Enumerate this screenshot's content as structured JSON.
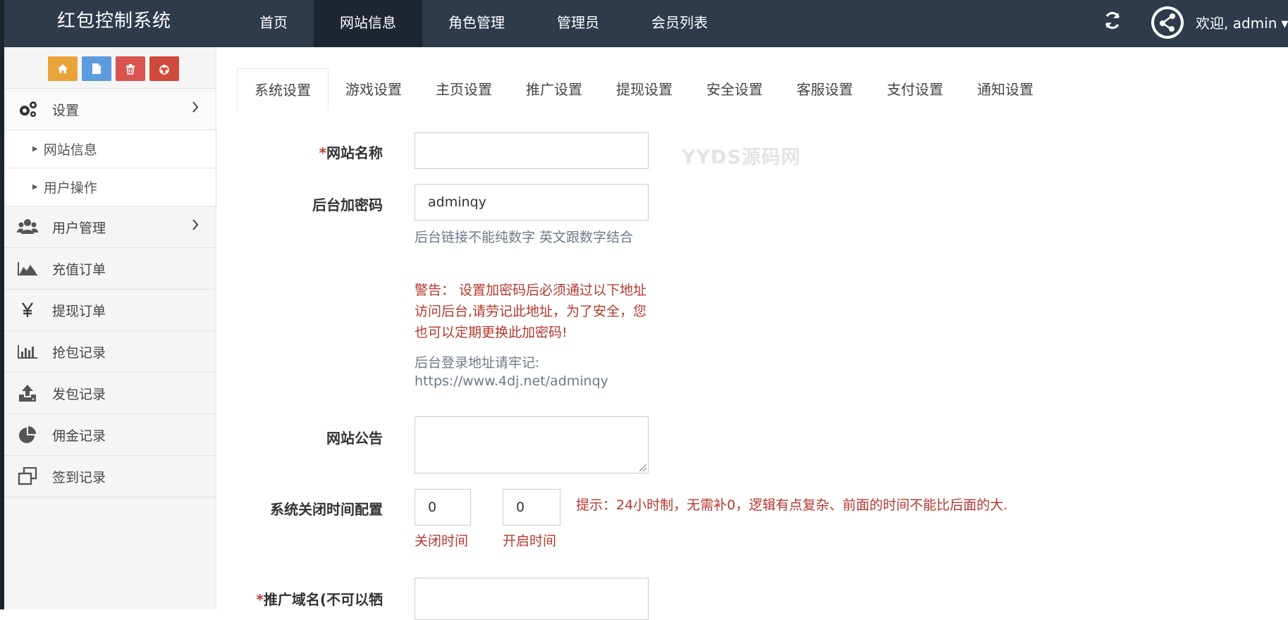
{
  "app": {
    "title": "红包控制系统"
  },
  "topnav": {
    "items": [
      {
        "label": "首页",
        "active": false
      },
      {
        "label": "网站信息",
        "active": true
      },
      {
        "label": "角色管理",
        "active": false
      },
      {
        "label": "管理员",
        "active": false
      },
      {
        "label": "会员列表",
        "active": false
      }
    ],
    "welcome": "欢迎, admin",
    "colors": {
      "bar": "#2f3a4b",
      "active": "#1e2632"
    }
  },
  "sidebar": {
    "shortcuts": [
      {
        "icon": "home-icon",
        "color": "#e8a33b"
      },
      {
        "icon": "file-icon",
        "color": "#5d9cdc"
      },
      {
        "icon": "trash-icon",
        "color": "#d9534f"
      },
      {
        "icon": "recycle-icon",
        "color": "#cf4a3c"
      }
    ],
    "settings": {
      "label": "设置",
      "icon": "gears-icon"
    },
    "settings_sub": [
      "网站信息",
      "用户操作"
    ],
    "users": {
      "label": "用户管理",
      "icon": "users-icon"
    },
    "items": [
      {
        "label": "充值订单",
        "icon": "area-chart-icon"
      },
      {
        "label": "提现订单",
        "icon": "yen-icon"
      },
      {
        "label": "抢包记录",
        "icon": "bar-chart-icon"
      },
      {
        "label": "发包记录",
        "icon": "upload-icon"
      },
      {
        "label": "佣金记录",
        "icon": "pie-chart-icon"
      },
      {
        "label": "签到记录",
        "icon": "clone-icon"
      }
    ]
  },
  "tabs": [
    {
      "label": "系统设置",
      "active": true
    },
    {
      "label": "游戏设置",
      "active": false
    },
    {
      "label": "主页设置",
      "active": false
    },
    {
      "label": "推广设置",
      "active": false
    },
    {
      "label": "提现设置",
      "active": false
    },
    {
      "label": "安全设置",
      "active": false
    },
    {
      "label": "客服设置",
      "active": false
    },
    {
      "label": "支付设置",
      "active": false
    },
    {
      "label": "通知设置",
      "active": false
    }
  ],
  "form": {
    "site_name": {
      "label": "网站名称",
      "required_mark": "*",
      "value": ""
    },
    "admin_code": {
      "label": "后台加密码",
      "value": "adminqy",
      "help1": "后台链接不能纯数字 英文跟数字结合",
      "warning": "警告： 设置加密码后必须通过以下地址访问后台,请劳记此地址，为了安全，您也可以定期更换此加密码!",
      "login_hint": "后台登录地址请牢记:",
      "login_url": "https://www.4dj.net/adminqy"
    },
    "notice": {
      "label": "网站公告",
      "value": ""
    },
    "close_time": {
      "label": "系统关闭时间配置",
      "close_value": "0",
      "open_value": "0",
      "close_caption": "关闭时间",
      "open_caption": "开启时间",
      "tip": "提示：24小时制，无需补0，逻辑有点复杂、前面的时间不能比后面的大."
    },
    "promo_domain": {
      "label": "推广域名(不可以牺",
      "required_mark": "*"
    }
  },
  "watermark": "YYDS源码网"
}
